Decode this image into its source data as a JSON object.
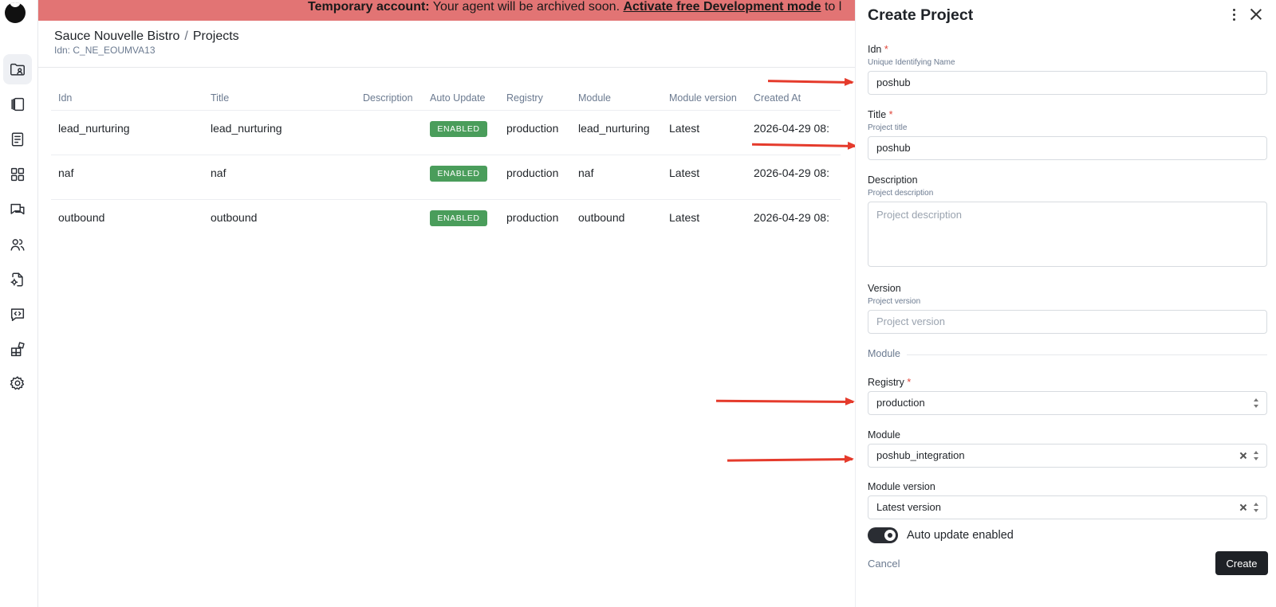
{
  "banner": {
    "bold": "Temporary account:",
    "text": " Your agent will be archived soon. ",
    "link": "Activate free Development mode",
    "tail": " to l"
  },
  "header": {
    "org": "Sauce Nouvelle Bistro",
    "separator": "/",
    "page": "Projects",
    "idn": "Idn: C_NE_EOUMVA13"
  },
  "sidebar": {
    "icons": [
      "folder-user-icon",
      "kanban-icon",
      "document-icon",
      "grid-icon",
      "chat-icon",
      "users-icon",
      "file-settings-icon",
      "code-chat-icon",
      "modules-icon",
      "gear-icon"
    ]
  },
  "table": {
    "columns": [
      "Idn",
      "Title",
      "Description",
      "Auto Update",
      "Registry",
      "Module",
      "Module version",
      "Created At"
    ],
    "rows": [
      {
        "idn": "lead_nurturing",
        "title": "lead_nurturing",
        "description": "",
        "auto_update": "ENABLED",
        "registry": "production",
        "module": "lead_nurturing",
        "module_version": "Latest",
        "created_at": "2026-04-29 08:"
      },
      {
        "idn": "naf",
        "title": "naf",
        "description": "",
        "auto_update": "ENABLED",
        "registry": "production",
        "module": "naf",
        "module_version": "Latest",
        "created_at": "2026-04-29 08:"
      },
      {
        "idn": "outbound",
        "title": "outbound",
        "description": "",
        "auto_update": "ENABLED",
        "registry": "production",
        "module": "outbound",
        "module_version": "Latest",
        "created_at": "2026-04-29 08:"
      }
    ]
  },
  "panel": {
    "title": "Create Project",
    "required_mark": "*",
    "idn": {
      "label": "Idn",
      "hint": "Unique Identifying Name",
      "value": "poshub"
    },
    "title_field": {
      "label": "Title",
      "hint": "Project title",
      "value": "poshub"
    },
    "description": {
      "label": "Description",
      "hint": "Project description",
      "placeholder": "Project description"
    },
    "version": {
      "label": "Version",
      "hint": "Project version",
      "placeholder": "Project version"
    },
    "module_section": "Module",
    "registry": {
      "label": "Registry",
      "value": "production"
    },
    "module": {
      "label": "Module",
      "value": "poshub_integration"
    },
    "module_version": {
      "label": "Module version",
      "value": "Latest version"
    },
    "auto_update": {
      "label": "Auto update enabled",
      "enabled": true
    },
    "cancel": "Cancel",
    "create": "Create"
  },
  "colors": {
    "banner": "#e27474",
    "badge": "#4a9d5b",
    "arrow": "#e53b2c",
    "primary_button": "#1e2126"
  }
}
